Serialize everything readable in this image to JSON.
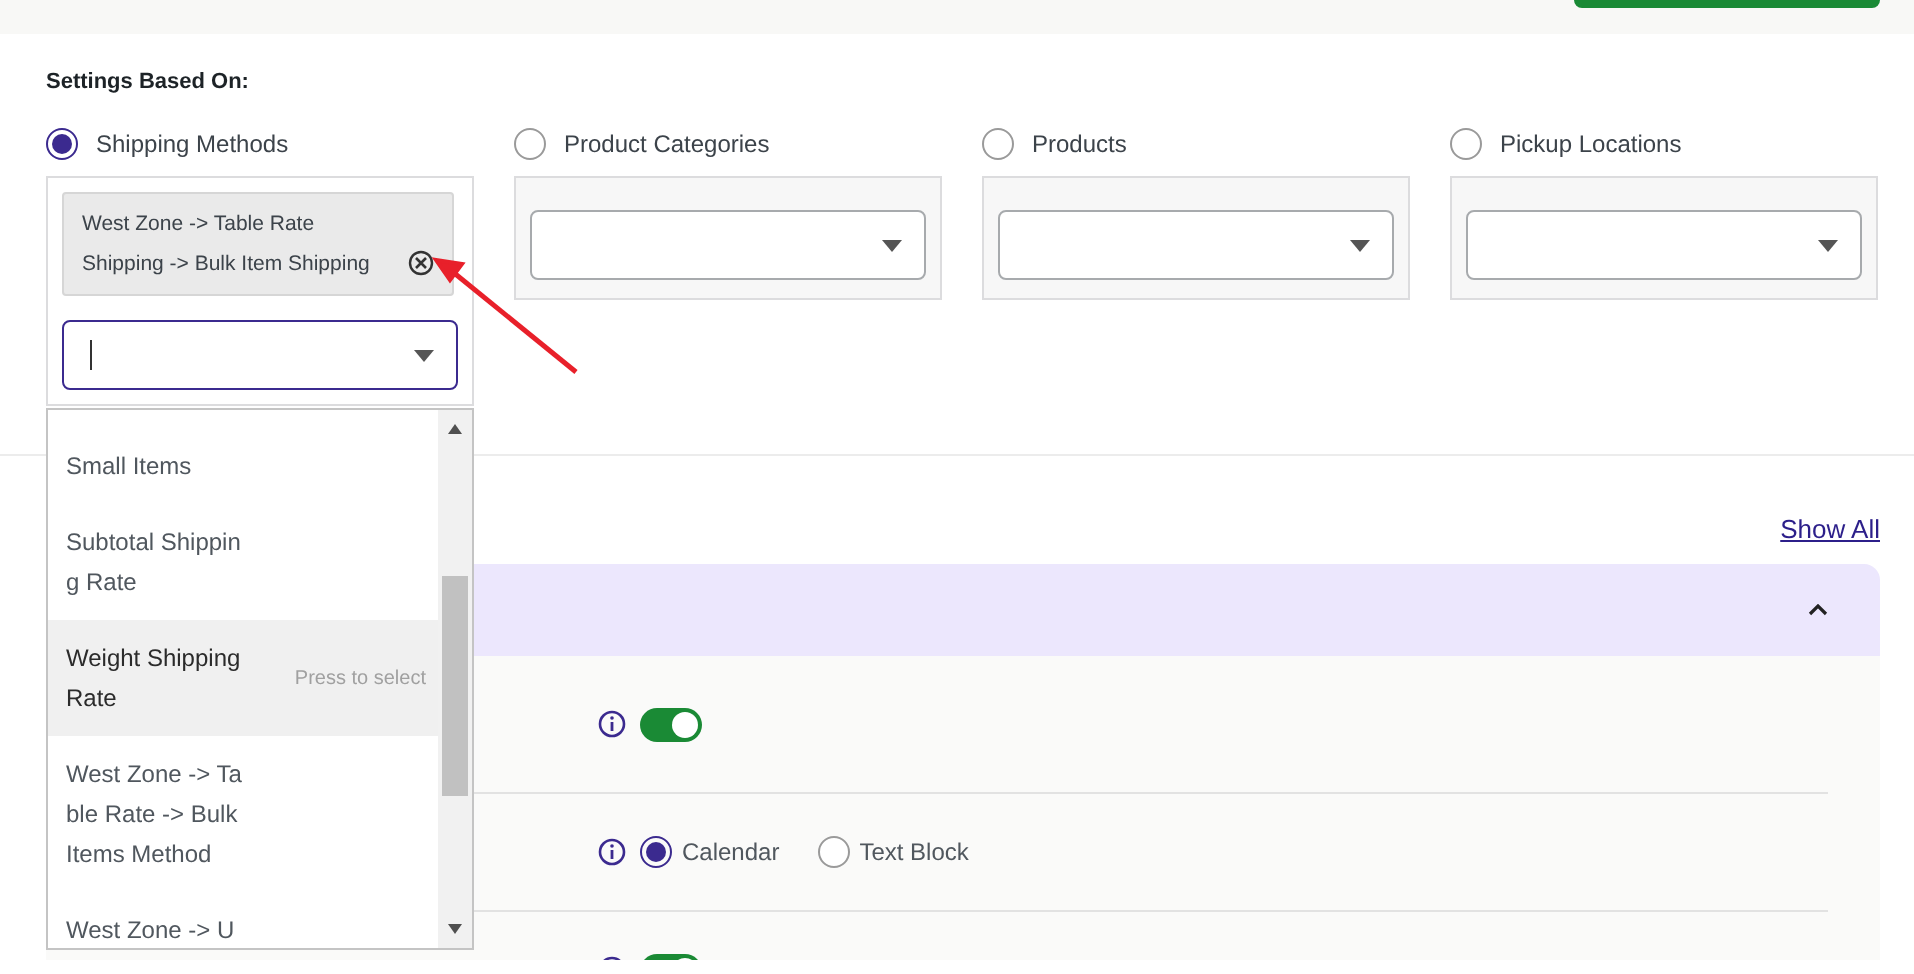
{
  "settings_label": "Settings Based On:",
  "options": [
    {
      "label": "Shipping Methods",
      "selected": true,
      "chips": [
        "West Zone -> Table Rate Shipping -> Bulk Item Shipping"
      ],
      "dropdown": {
        "items": [
          {
            "label": "Small Items",
            "selected": false
          },
          {
            "label": "Subtotal Shipping Rate",
            "selected": false
          },
          {
            "label": "Weight Shipping Rate",
            "selected": true,
            "hint": "Press to select"
          },
          {
            "label": "West Zone -> Table Rate -> Bulk Items Method",
            "selected": false
          },
          {
            "label": "West Zone -> U",
            "selected": false
          }
        ]
      }
    },
    {
      "label": "Product Categories",
      "selected": false
    },
    {
      "label": "Products",
      "selected": false
    },
    {
      "label": "Pickup Locations",
      "selected": false
    }
  ],
  "show_all": "Show All",
  "panel": {
    "expanded": true,
    "rows": [
      {
        "kind": "toggle",
        "on": true
      },
      {
        "kind": "radio",
        "choices": [
          {
            "label": "Calendar",
            "selected": true
          },
          {
            "label": "Text Block",
            "selected": false
          }
        ]
      },
      {
        "kind": "toggle",
        "on": true
      }
    ]
  }
}
